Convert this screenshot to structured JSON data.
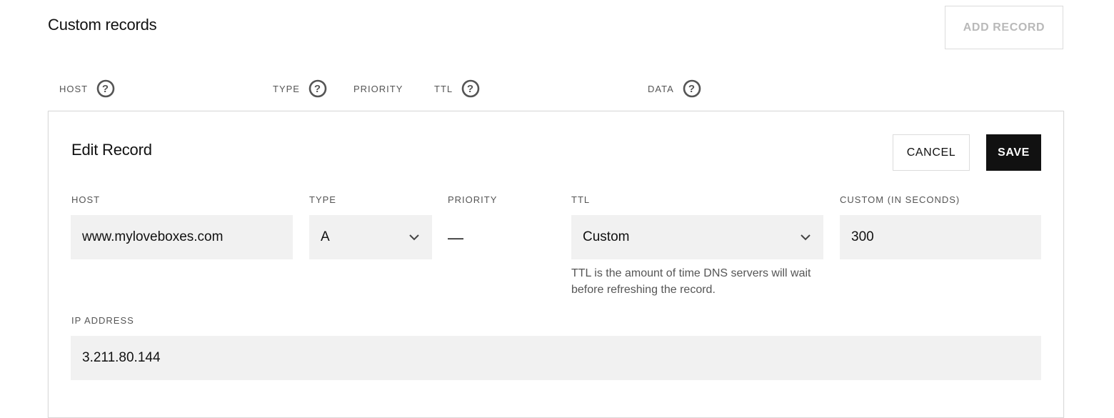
{
  "section": {
    "title": "Custom records",
    "add_record_label": "ADD RECORD"
  },
  "columns": {
    "host": "HOST",
    "type": "TYPE",
    "priority": "PRIORITY",
    "ttl": "TTL",
    "data": "DATA",
    "help_icon": "question-circle-icon"
  },
  "edit": {
    "title": "Edit Record",
    "cancel_label": "CANCEL",
    "save_label": "SAVE",
    "host": {
      "label": "HOST",
      "value": "www.myloveboxes.com"
    },
    "type": {
      "label": "TYPE",
      "value": "A"
    },
    "priority": {
      "label": "PRIORITY",
      "value": "—"
    },
    "ttl": {
      "label": "TTL",
      "value": "Custom",
      "hint": "TTL is the amount of time DNS servers will wait before refreshing the record."
    },
    "custom": {
      "label": "CUSTOM (IN SECONDS)",
      "value": "300"
    },
    "ip": {
      "label": "IP ADDRESS",
      "value": "3.211.80.144"
    }
  },
  "colors": {
    "accent": "#111111",
    "field_bg": "#f1f1f1",
    "muted": "#555555",
    "disabled": "#b9b9b9"
  }
}
